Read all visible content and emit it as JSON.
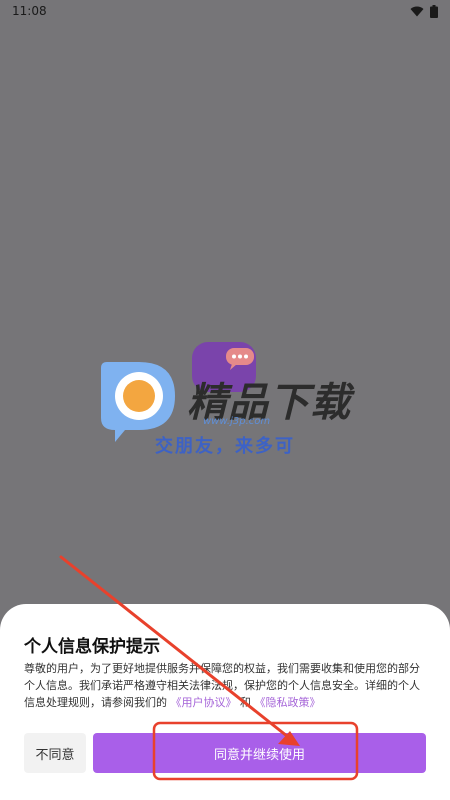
{
  "status_bar": {
    "time": "11:08"
  },
  "watermark": {
    "brand": "精品下载",
    "url": "www.j3p.com",
    "slogan": "交朋友，来多可"
  },
  "dialog": {
    "title": "个人信息保护提示",
    "body_text": "尊敬的用户，为了更好地提供服务并保障您的权益，我们需要收集和使用您的部分个人信息。我们承诺严格遵守相关法律法规，保护您的个人信息安全。详细的个人信息处理规则，请参阅我们的",
    "user_agreement": "《用户协议》",
    "connector": "和",
    "privacy_policy": "《隐私政策》",
    "disagree_label": "不同意",
    "agree_label": "同意并继续使用"
  },
  "colors": {
    "overlay": "#767578",
    "accent": "#a95fe9",
    "link": "#a564d8",
    "annotation": "#e8412c"
  }
}
